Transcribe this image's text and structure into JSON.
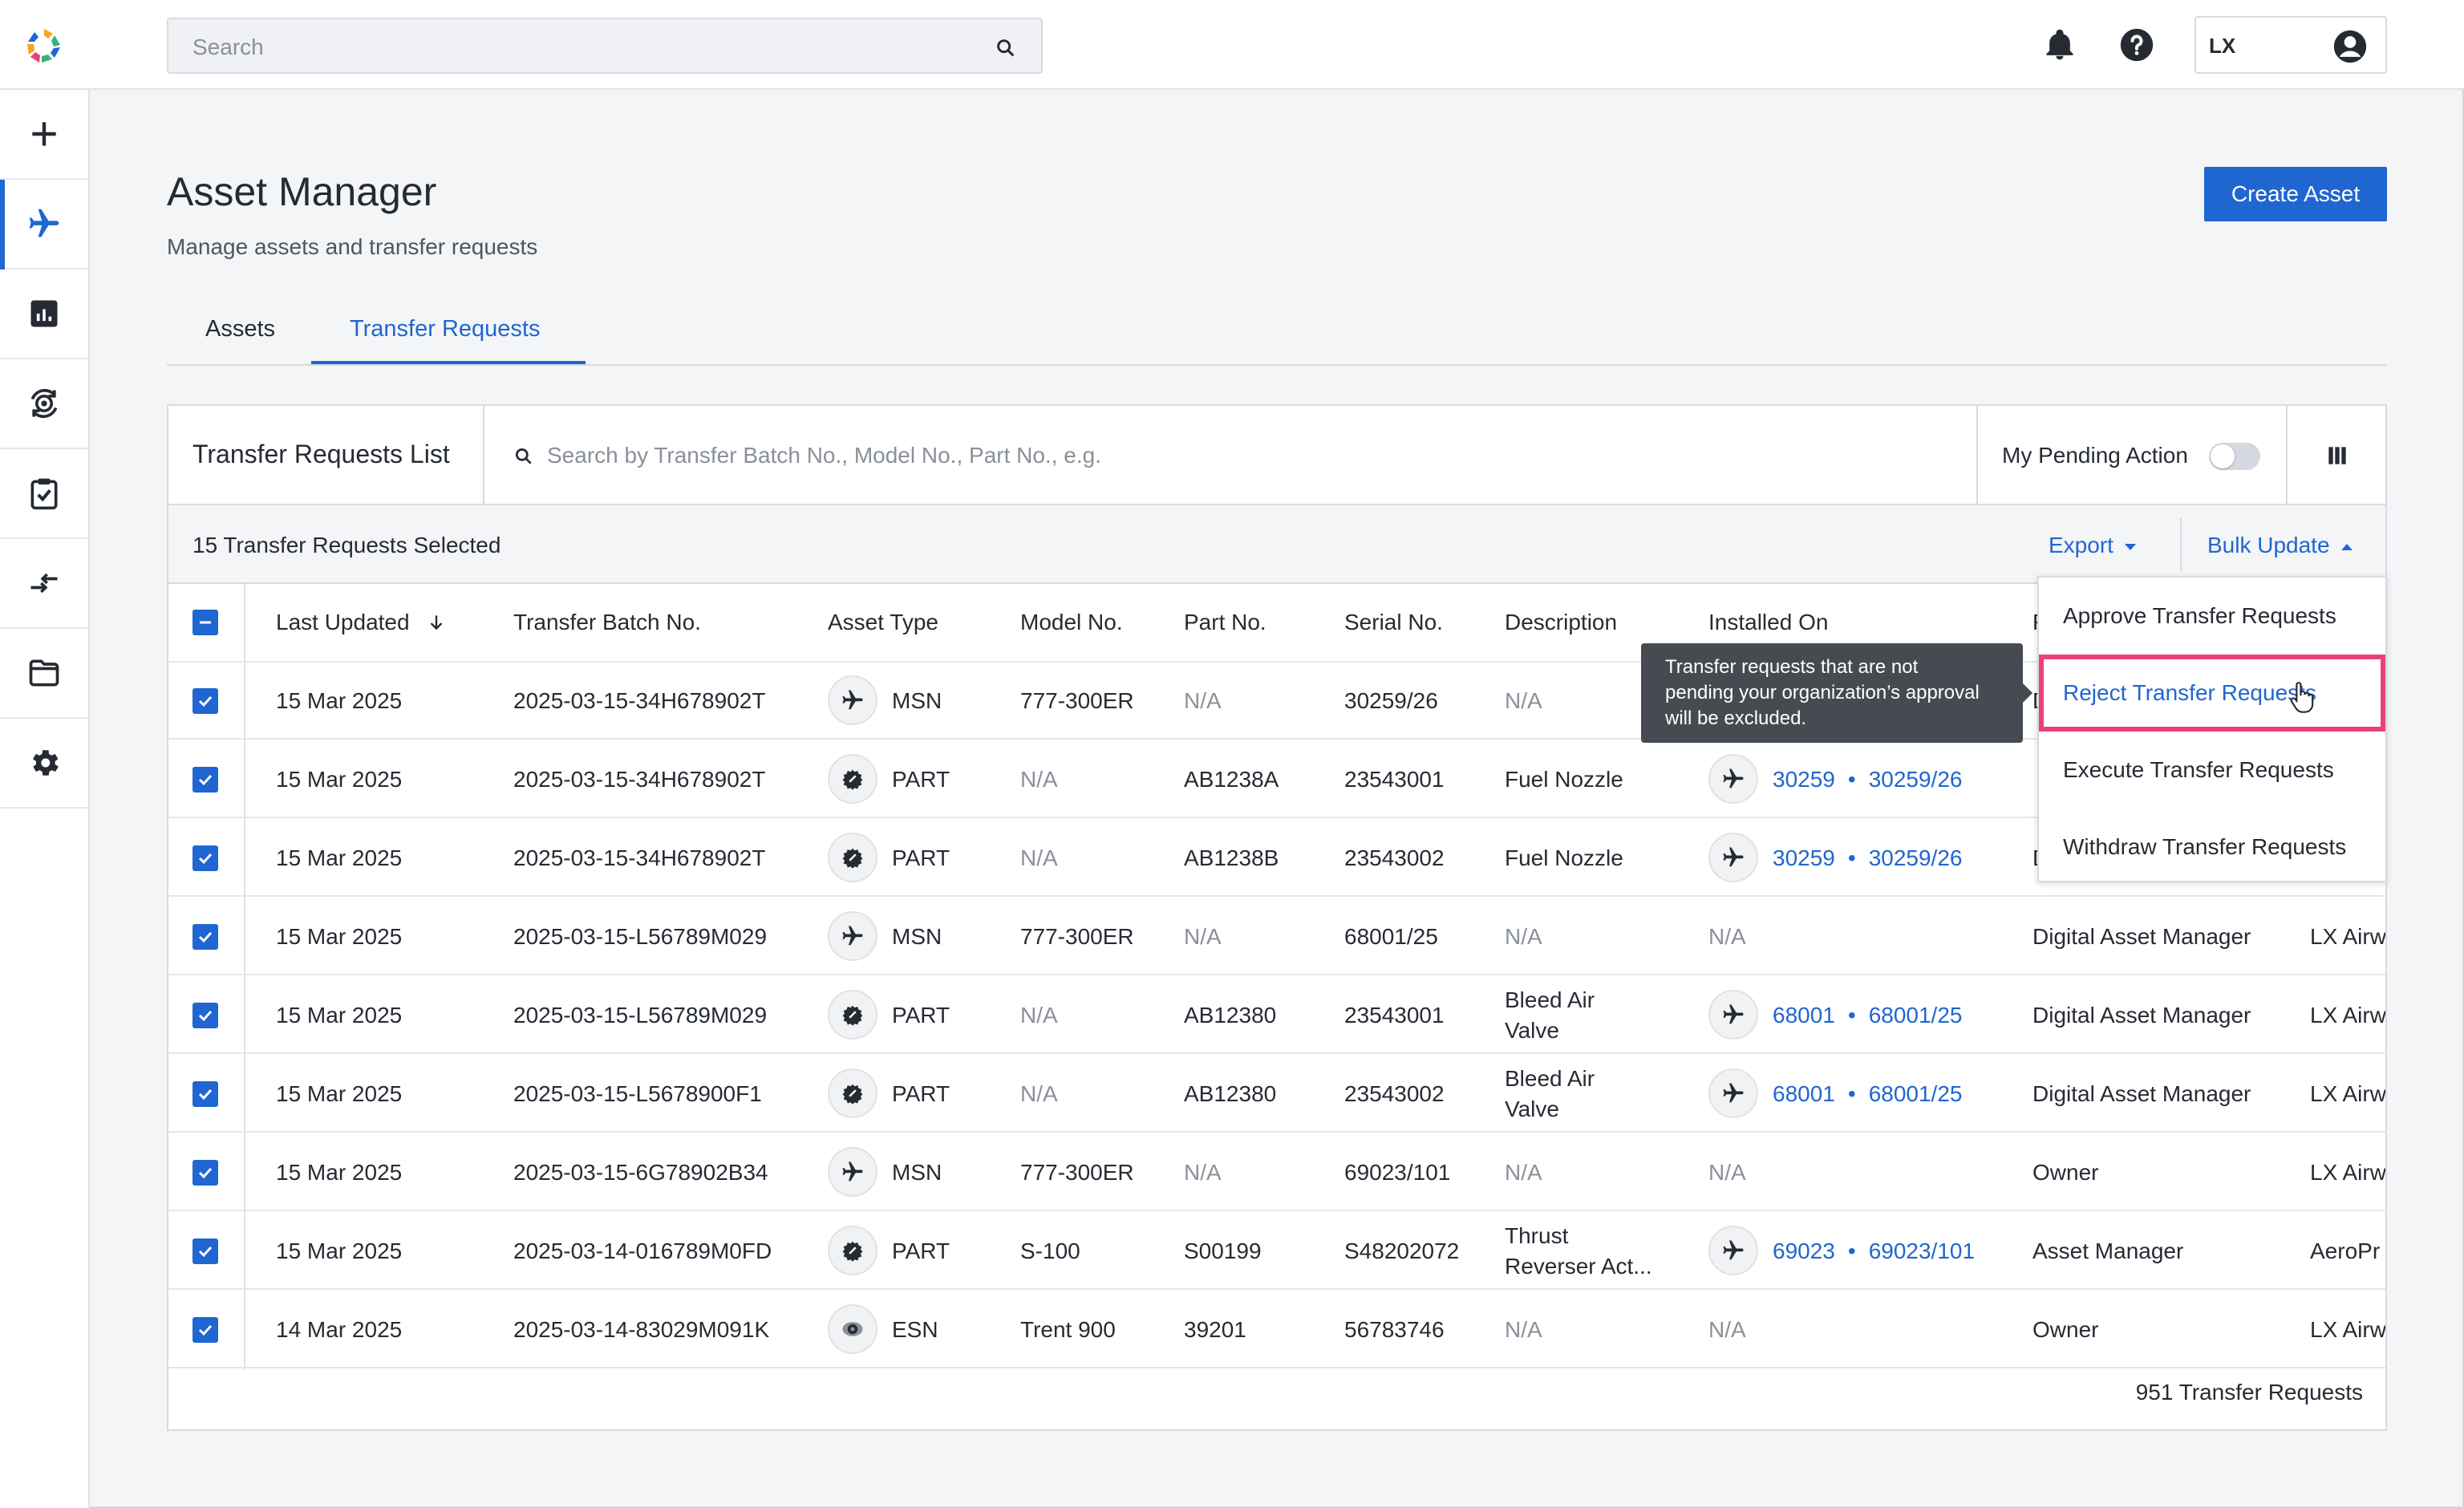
{
  "topbar": {
    "search_placeholder": "Search",
    "user_initials": "LX"
  },
  "sidebar": {
    "items": [
      {
        "icon": "plus-icon"
      },
      {
        "icon": "airplane-icon",
        "active": true
      },
      {
        "icon": "chart-icon"
      },
      {
        "icon": "engine-sync-icon"
      },
      {
        "icon": "clipboard-check-icon"
      },
      {
        "icon": "transfer-arrows-icon"
      },
      {
        "icon": "folder-icon"
      },
      {
        "icon": "gear-icon"
      }
    ]
  },
  "page": {
    "title": "Asset Manager",
    "subtitle": "Manage assets and transfer requests",
    "create_button": "Create Asset"
  },
  "tabs": [
    {
      "label": "Assets",
      "active": false
    },
    {
      "label": "Transfer Requests",
      "active": true
    }
  ],
  "table": {
    "title": "Transfer Requests List",
    "search_placeholder": "Search by Transfer Batch No., Model No., Part No., e.g.",
    "pending_toggle_label": "My Pending Action",
    "selected_text": "15 Transfer Requests Selected",
    "export_label": "Export",
    "bulk_update_label": "Bulk Update",
    "columns": [
      "Last Updated",
      "Transfer Batch No.",
      "Asset Type",
      "Model No.",
      "Part No.",
      "Serial No.",
      "Description",
      "Installed On",
      "F"
    ],
    "rows": [
      {
        "date": "15 Mar 2025",
        "batch": "2025-03-15-34H678902T",
        "type": "MSN",
        "type_icon": "airplane-icon",
        "model": "777-300ER",
        "part": "N/A",
        "serial": "30259/26",
        "desc": [
          "N/A"
        ],
        "installed_msn": "",
        "installed_sn": "",
        "installed_na": "",
        "org": "D",
        "owner": ""
      },
      {
        "date": "15 Mar 2025",
        "batch": "2025-03-15-34H678902T",
        "type": "PART",
        "type_icon": "part-icon",
        "model": "N/A",
        "part": "AB1238A",
        "serial": "23543001",
        "desc": [
          "Fuel Nozzle"
        ],
        "installed_msn": "30259",
        "installed_sn": "30259/26",
        "installed_na": "",
        "org": "",
        "owner": ""
      },
      {
        "date": "15 Mar 2025",
        "batch": "2025-03-15-34H678902T",
        "type": "PART",
        "type_icon": "part-icon",
        "model": "N/A",
        "part": "AB1238B",
        "serial": "23543002",
        "desc": [
          "Fuel Nozzle"
        ],
        "installed_msn": "30259",
        "installed_sn": "30259/26",
        "installed_na": "",
        "org": "D",
        "owner": ""
      },
      {
        "date": "15 Mar 2025",
        "batch": "2025-03-15-L56789M029",
        "type": "MSN",
        "type_icon": "airplane-icon",
        "model": "777-300ER",
        "part": "N/A",
        "serial": "68001/25",
        "desc": [
          "N/A"
        ],
        "installed_msn": "",
        "installed_sn": "",
        "installed_na": "N/A",
        "org": "Digital Asset Manager",
        "owner": "LX Airw"
      },
      {
        "date": "15 Mar 2025",
        "batch": "2025-03-15-L56789M029",
        "type": "PART",
        "type_icon": "part-icon",
        "model": "N/A",
        "part": "AB12380",
        "serial": "23543001",
        "desc": [
          "Bleed Air",
          "Valve"
        ],
        "installed_msn": "68001",
        "installed_sn": "68001/25",
        "installed_na": "",
        "org": "Digital Asset Manager",
        "owner": "LX Airw"
      },
      {
        "date": "15 Mar 2025",
        "batch": "2025-03-15-L5678900F1",
        "type": "PART",
        "type_icon": "part-icon",
        "model": "N/A",
        "part": "AB12380",
        "serial": "23543002",
        "desc": [
          "Bleed Air",
          "Valve"
        ],
        "installed_msn": "68001",
        "installed_sn": "68001/25",
        "installed_na": "",
        "org": "Digital Asset Manager",
        "owner": "LX Airw"
      },
      {
        "date": "15 Mar 2025",
        "batch": "2025-03-15-6G78902B34",
        "type": "MSN",
        "type_icon": "airplane-icon",
        "model": "777-300ER",
        "part": "N/A",
        "serial": "69023/101",
        "desc": [
          "N/A"
        ],
        "installed_msn": "",
        "installed_sn": "",
        "installed_na": "N/A",
        "org": "Owner",
        "owner": "LX Airw"
      },
      {
        "date": "15 Mar 2025",
        "batch": "2025-03-14-016789M0FD",
        "type": "PART",
        "type_icon": "part-icon",
        "model": "S-100",
        "part": "S00199",
        "serial": "S48202072",
        "desc": [
          "Thrust",
          "Reverser Act..."
        ],
        "installed_msn": "69023",
        "installed_sn": "69023/101",
        "installed_na": "",
        "org": "Asset Manager",
        "owner": "AeroPr"
      },
      {
        "date": "14 Mar 2025",
        "batch": "2025-03-14-83029M091K",
        "type": "ESN",
        "type_icon": "engine-icon",
        "model": "Trent 900",
        "part": "39201",
        "serial": "56783746",
        "desc": [
          "N/A"
        ],
        "installed_msn": "",
        "installed_sn": "",
        "installed_na": "N/A",
        "org": "Owner",
        "owner": "LX Airw"
      }
    ],
    "total": "951 Transfer Requests"
  },
  "tooltip": {
    "lines": [
      "Transfer requests that are not",
      "pending your organization’s approval",
      "will be excluded."
    ]
  },
  "bulk_menu": {
    "items": [
      "Approve Transfer Requests",
      "Reject Transfer Requests",
      "Execute Transfer Requests",
      "Withdraw Transfer Requests"
    ],
    "highlighted": "Reject Transfer Requests"
  },
  "colors": {
    "accent": "#1f66d1",
    "highlight_border": "#e8407a",
    "tooltip_bg": "#464b52"
  }
}
